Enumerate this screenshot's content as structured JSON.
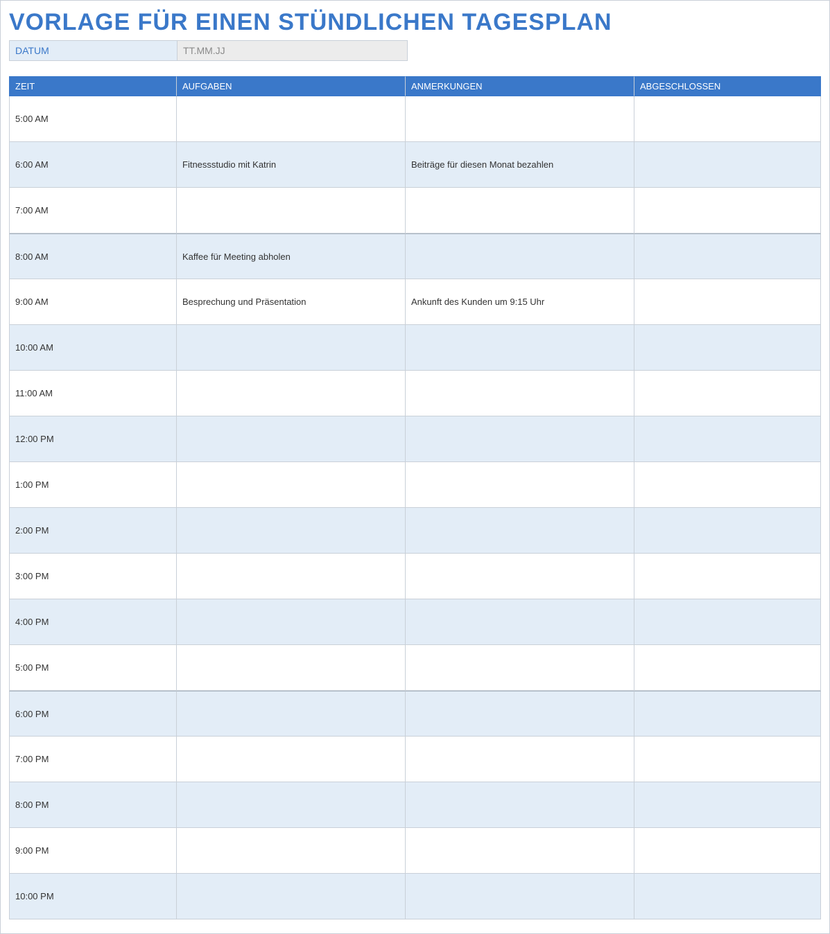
{
  "title": "VORLAGE FÜR EINEN STÜNDLICHEN TAGESPLAN",
  "date": {
    "label": "DATUM",
    "value": "TT.MM.JJ"
  },
  "columns": {
    "zeit": "ZEIT",
    "aufgaben": "AUFGABEN",
    "anmerkungen": "ANMERKUNGEN",
    "abgeschlossen": "ABGESCHLOSSEN"
  },
  "rows": [
    {
      "zeit": "5:00 AM",
      "aufgaben": "",
      "anmerkungen": "",
      "abgeschlossen": ""
    },
    {
      "zeit": "6:00 AM",
      "aufgaben": "Fitnessstudio mit Katrin",
      "anmerkungen": "Beiträge für diesen Monat bezahlen",
      "abgeschlossen": ""
    },
    {
      "zeit": "7:00 AM",
      "aufgaben": "",
      "anmerkungen": "",
      "abgeschlossen": ""
    },
    {
      "zeit": "8:00 AM",
      "aufgaben": "Kaffee für Meeting abholen",
      "anmerkungen": "",
      "abgeschlossen": ""
    },
    {
      "zeit": "9:00 AM",
      "aufgaben": "Besprechung und Präsentation",
      "anmerkungen": "Ankunft des Kunden um 9:15 Uhr",
      "abgeschlossen": ""
    },
    {
      "zeit": "10:00 AM",
      "aufgaben": "",
      "anmerkungen": "",
      "abgeschlossen": ""
    },
    {
      "zeit": "11:00 AM",
      "aufgaben": "",
      "anmerkungen": "",
      "abgeschlossen": ""
    },
    {
      "zeit": "12:00 PM",
      "aufgaben": "",
      "anmerkungen": "",
      "abgeschlossen": ""
    },
    {
      "zeit": "1:00 PM",
      "aufgaben": "",
      "anmerkungen": "",
      "abgeschlossen": ""
    },
    {
      "zeit": "2:00 PM",
      "aufgaben": "",
      "anmerkungen": "",
      "abgeschlossen": ""
    },
    {
      "zeit": "3:00 PM",
      "aufgaben": "",
      "anmerkungen": "",
      "abgeschlossen": ""
    },
    {
      "zeit": "4:00 PM",
      "aufgaben": "",
      "anmerkungen": "",
      "abgeschlossen": ""
    },
    {
      "zeit": "5:00 PM",
      "aufgaben": "",
      "anmerkungen": "",
      "abgeschlossen": ""
    },
    {
      "zeit": "6:00 PM",
      "aufgaben": "",
      "anmerkungen": "",
      "abgeschlossen": ""
    },
    {
      "zeit": "7:00 PM",
      "aufgaben": "",
      "anmerkungen": "",
      "abgeschlossen": ""
    },
    {
      "zeit": "8:00 PM",
      "aufgaben": "",
      "anmerkungen": "",
      "abgeschlossen": ""
    },
    {
      "zeit": "9:00 PM",
      "aufgaben": "",
      "anmerkungen": "",
      "abgeschlossen": ""
    },
    {
      "zeit": "10:00 PM",
      "aufgaben": "",
      "anmerkungen": "",
      "abgeschlossen": ""
    }
  ],
  "separator_indices": [
    3,
    13
  ]
}
